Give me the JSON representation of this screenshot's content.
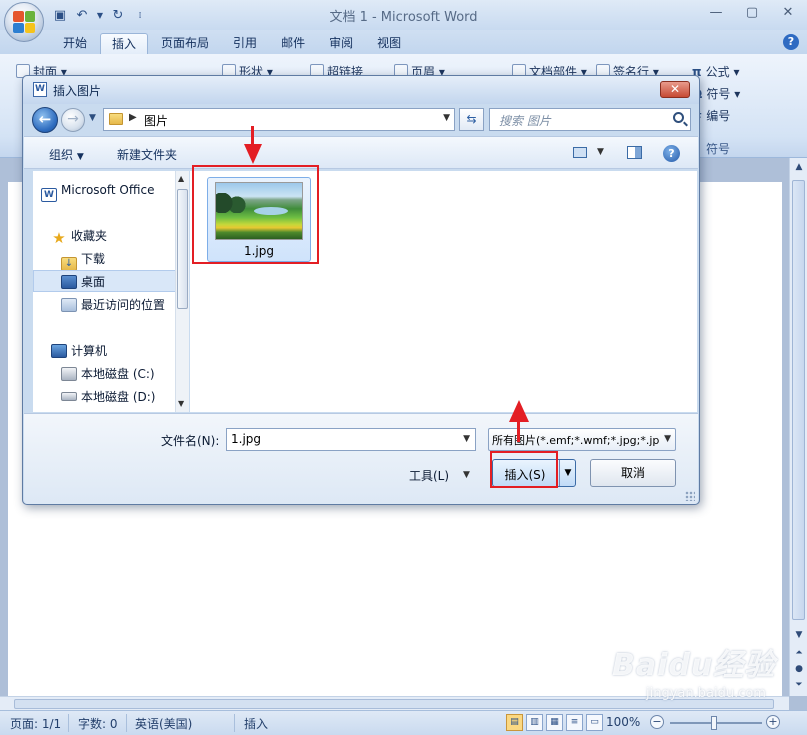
{
  "word": {
    "title": "文档 1 - Microsoft Word",
    "tabs": [
      "开始",
      "插入",
      "页面布局",
      "引用",
      "邮件",
      "审阅",
      "视图"
    ],
    "active_tab": "插入",
    "ribbon": {
      "cover": "封面",
      "shapes": "形状",
      "hyperlink": "超链接",
      "header": "页眉",
      "doc_parts": "文档部件",
      "signature": "签名行",
      "equation": "公式",
      "symbol": "符号",
      "numbering": "编号",
      "symbol_group_label": "符号"
    }
  },
  "dialog": {
    "title": "插入图片",
    "address": "图片",
    "search_placeholder": "搜索 图片",
    "toolbar": {
      "organize": "组织",
      "new_folder": "新建文件夹"
    },
    "nav": {
      "microsoft_office": "Microsoft Office",
      "favorites": "收藏夹",
      "downloads": "下载",
      "desktop": "桌面",
      "recent": "最近访问的位置",
      "computer": "计算机",
      "drive_c": "本地磁盘 (C:)",
      "drive_d": "本地磁盘 (D:)"
    },
    "file": {
      "name": "1.jpg"
    },
    "filename_label": "文件名(N):",
    "filename_value": "1.jpg",
    "filetype_value": "所有图片(*.emf;*.wmf;*.jpg;*.jp",
    "tools_label": "工具(L)",
    "insert_label": "插入(S)",
    "cancel_label": "取消"
  },
  "status": {
    "page": "页面: 1/1",
    "words": "字数: 0",
    "language": "英语(美国)",
    "mode": "插入",
    "zoom": "100%"
  },
  "watermark": {
    "brand": "Baidu经验",
    "url": "jingyan.baidu.com"
  },
  "colors": {
    "annotation": "#e31e24",
    "selection": "#cfe3fb",
    "accent": "#2e6cbf"
  }
}
